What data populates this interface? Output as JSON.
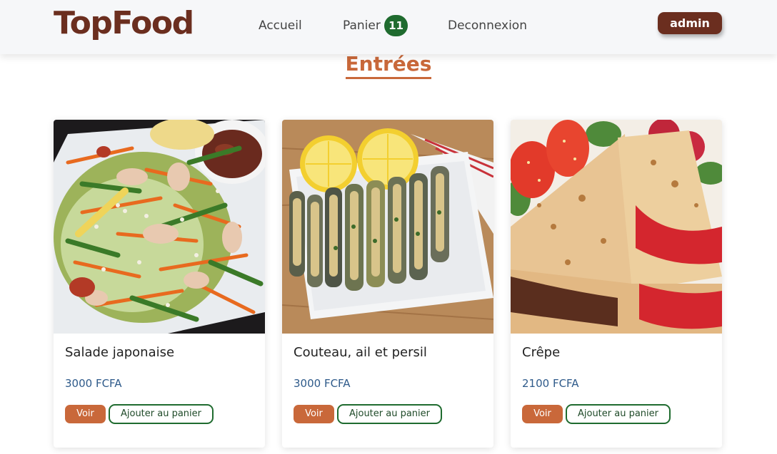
{
  "header": {
    "logo": "TopFood",
    "nav": {
      "accueil": "Accueil",
      "panier": "Panier",
      "cart_count": "11",
      "deconnexion": "Deconnexion"
    },
    "user_button": "admin"
  },
  "section": {
    "title": "Entrées"
  },
  "products": [
    {
      "name": "Salade japonaise",
      "price": "3000 FCFA",
      "view_label": "Voir",
      "add_label": "Ajouter au panier"
    },
    {
      "name": "Couteau, ail et persil",
      "price": "3000 FCFA",
      "view_label": "Voir",
      "add_label": "Ajouter au panier"
    },
    {
      "name": "Crêpe",
      "price": "2100 FCFA",
      "view_label": "Voir",
      "add_label": "Ajouter au panier"
    }
  ],
  "colors": {
    "brand_brown": "#6b2e1f",
    "accent_orange": "#c9683a",
    "badge_green": "#1f6b2f",
    "price_blue": "#2e5a8a"
  },
  "icons": [
    "salad-photo",
    "razor-clams-photo",
    "crepe-photo"
  ]
}
